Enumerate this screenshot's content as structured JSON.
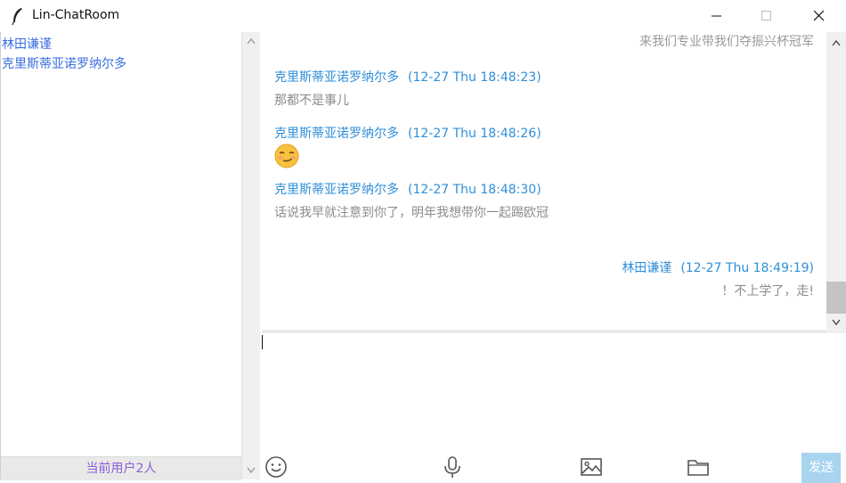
{
  "window": {
    "title": "Lin-ChatRoom"
  },
  "sidebar": {
    "users": [
      "林田谦谨",
      "克里斯蒂亚诺罗纳尔多"
    ],
    "online_count": "当前用户2人"
  },
  "chat": {
    "top_partial": "来我们专业带我们夺振兴杯冠军",
    "messages": [
      {
        "sender": "克里斯蒂亚诺罗纳尔多",
        "time": "(12-27 Thu 18:48:23)",
        "text": "那都不是事儿"
      },
      {
        "sender": "克里斯蒂亚诺罗纳尔多",
        "time": "(12-27 Thu 18:48:26)",
        "emoji": "smirk-emoji"
      },
      {
        "sender": "克里斯蒂亚诺罗纳尔多",
        "time": "(12-27 Thu 18:48:30)",
        "text": "话说我早就注意到你了，明年我想带你一起踢欧冠"
      },
      {
        "sender": "林田谦谨",
        "time": "(12-27 Thu 18:49:19)",
        "text": "！不上学了，走!"
      }
    ]
  },
  "input": {
    "value": ""
  },
  "toolbar": {
    "icons": [
      "emoji-icon",
      "microphone-icon",
      "image-icon",
      "folder-icon"
    ],
    "send_label": "发送"
  },
  "colors": {
    "sender": "#2f8fd8",
    "user_list": "#3a6ee0",
    "online_count": "#8a5ed6",
    "send_button": "#a8d4ef"
  }
}
